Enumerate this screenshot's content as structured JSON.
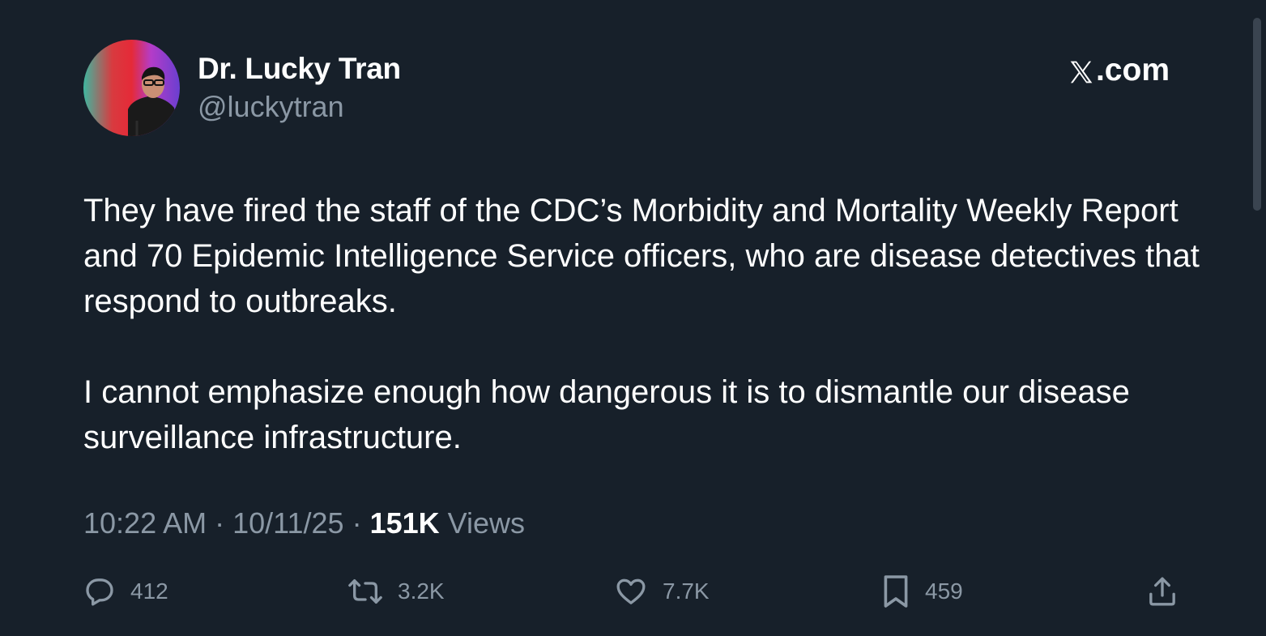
{
  "author": {
    "display_name": "Dr. Lucky Tran",
    "handle": "@luckytran"
  },
  "brand": {
    "label": ".com"
  },
  "tweet": {
    "paragraphs": [
      "They have fired the staff of the CDC’s Morbidity and Mortality Weekly Report and 70 Epidemic Intelligence Service officers, who are disease detectives that respond to outbreaks.",
      "I cannot emphasize enough how dangerous it is to dismantle our disease surveillance infrastructure."
    ]
  },
  "meta": {
    "time": "10:22 AM",
    "separator": " · ",
    "date": "10/11/25",
    "views_count": "151K",
    "views_label": " Views"
  },
  "actions": {
    "replies": "412",
    "reposts": "3.2K",
    "likes": "7.7K",
    "bookmarks": "459"
  },
  "colors": {
    "background": "#17202a",
    "primary_text": "#ffffff",
    "secondary_text": "#8b98a5"
  },
  "icons": [
    "reply-icon",
    "repost-icon",
    "like-icon",
    "bookmark-icon",
    "share-icon",
    "x-logo-icon"
  ]
}
